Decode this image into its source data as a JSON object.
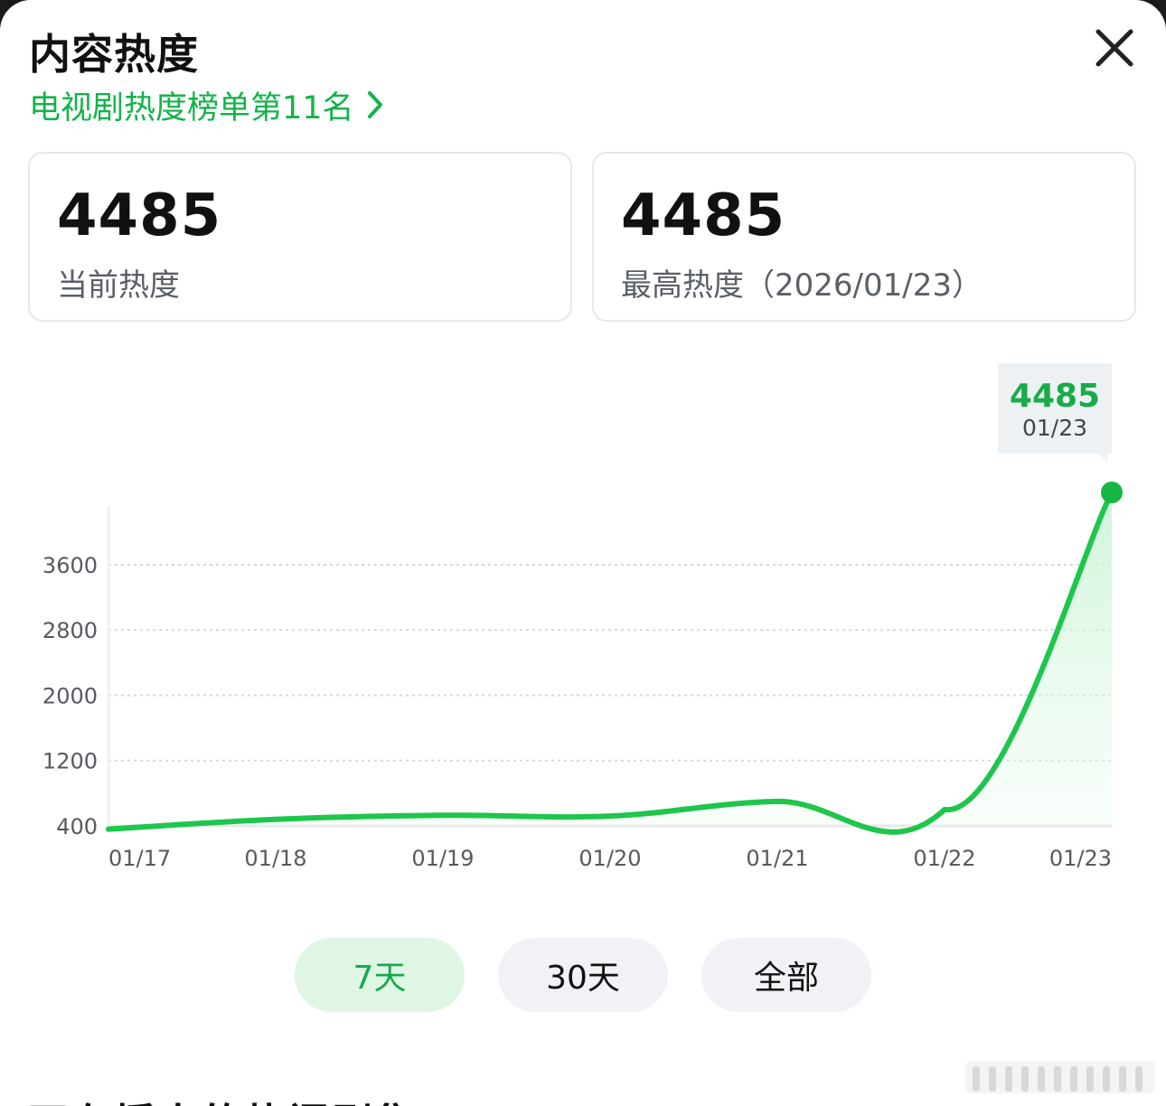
{
  "header": {
    "title": "内容热度",
    "rank_link": "电视剧热度榜单第11名"
  },
  "stats": [
    {
      "value": "4485",
      "label": "当前热度"
    },
    {
      "value": "4485",
      "label": "最高热度（2026/01/23）"
    }
  ],
  "tooltip": {
    "value": "4485",
    "date": "01/23"
  },
  "chart_data": {
    "type": "area",
    "x": [
      "01/17",
      "01/18",
      "01/19",
      "01/20",
      "01/21",
      "01/22",
      "01/23"
    ],
    "y_ticks": [
      "400",
      "1200",
      "2000",
      "2800",
      "3600"
    ],
    "ylim": [
      400,
      4485
    ],
    "series": [
      {
        "values": [
          360,
          480,
          530,
          520,
          700,
          600,
          4485
        ]
      }
    ],
    "grid": true,
    "colors": {
      "line": "#1ec64b",
      "fill": "#c8f3d3",
      "grid": "#d5d7da",
      "axis_text": "#555a60"
    }
  },
  "range_tabs": [
    {
      "label": "7天",
      "active": true
    },
    {
      "label": "30天",
      "active": false
    },
    {
      "label": "全部",
      "active": false
    }
  ],
  "below_fold_text": "正在播出的热门剧集",
  "colors": {
    "accent": "#13b34a",
    "tab_active_bg": "#dff6e5",
    "tab_bg": "#f0f2f5"
  }
}
